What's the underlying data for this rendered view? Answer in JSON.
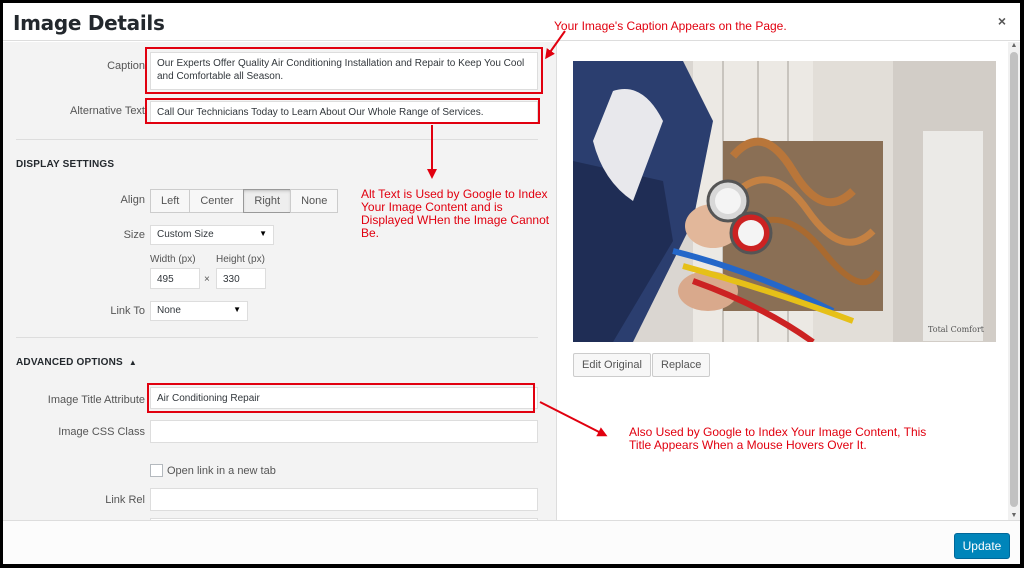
{
  "modal": {
    "title": "Image Details",
    "close_glyph": "×",
    "update_label": "Update"
  },
  "fields": {
    "caption_label": "Caption",
    "caption_value": "Our Experts Offer Quality Air Conditioning Installation and Repair to Keep You Cool and Comfortable all Season.",
    "alt_label": "Alternative Text",
    "alt_value": "Call Our Technicians Today to Learn About Our Whole Range of Services."
  },
  "display_settings": {
    "heading": "DISPLAY SETTINGS",
    "align_label": "Align",
    "align_options": [
      "Left",
      "Center",
      "Right",
      "None"
    ],
    "align_selected": "Right",
    "size_label": "Size",
    "size_value": "Custom Size",
    "width_label": "Width (px)",
    "width_value": "495",
    "height_label": "Height (px)",
    "height_value": "330",
    "times_glyph": "×",
    "link_label": "Link To",
    "link_value": "None"
  },
  "advanced": {
    "heading": "ADVANCED OPTIONS",
    "toggle_glyph": "▲",
    "title_attr_label": "Image Title Attribute",
    "title_attr_value": "Air Conditioning Repair",
    "css_class_label": "Image CSS Class",
    "css_class_value": "",
    "new_tab_label": "Open link in a new tab",
    "link_rel_label": "Link Rel",
    "link_rel_value": ""
  },
  "image_actions": {
    "edit_original": "Edit Original",
    "replace": "Replace",
    "watermark": "Total Comfort"
  },
  "annotations": {
    "caption_note": "Your Image's Caption Appears on the Page.",
    "alt_note": "Alt Text is Used by Google to Index Your Image Content and is Displayed WHen the Image Cannot Be.",
    "title_note": "Also Used by Google to Index Your Image Content, This Title Appears When a Mouse Hovers Over It."
  },
  "colors": {
    "annotation_red": "#e1000f",
    "primary_button": "#0085ba"
  }
}
